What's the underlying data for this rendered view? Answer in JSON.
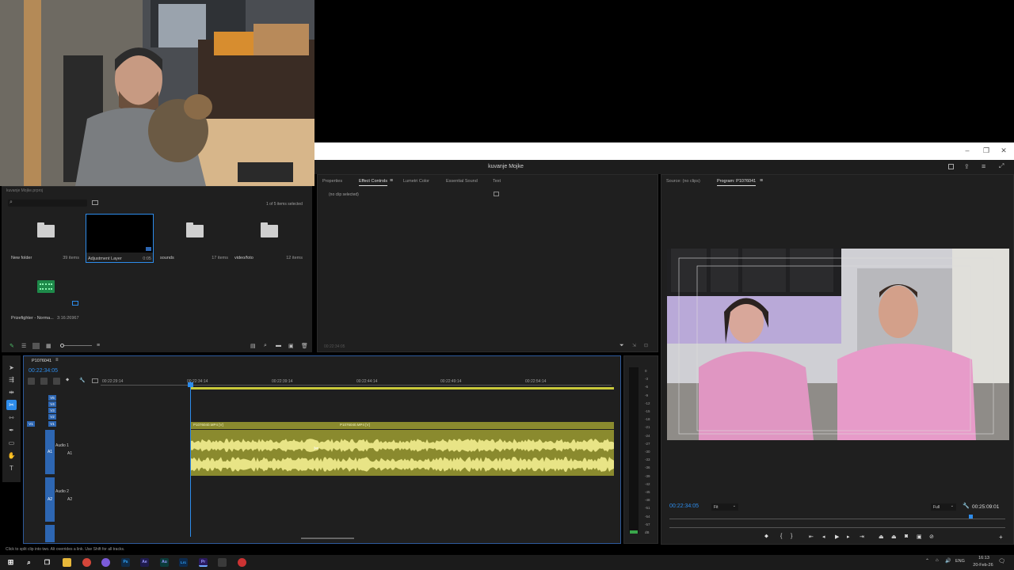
{
  "window": {
    "title": "kuvanje Mojke",
    "controls": [
      "–",
      "❐",
      "✕"
    ]
  },
  "project": {
    "path": "kuvanje Mojke.prproj",
    "items_selected": "1 of 5 items selected",
    "items": [
      {
        "name": "New folder",
        "count": "39 items",
        "kind": "folder"
      },
      {
        "name": "Adjustment Layer",
        "count": "0:05",
        "kind": "adjustment"
      },
      {
        "name": "sounds",
        "count": "17 items",
        "kind": "folder"
      },
      {
        "name": "video/foto",
        "count": "12 items",
        "kind": "folder"
      },
      {
        "name": "Prizefighter - Norma...",
        "count": "3:16:26967",
        "kind": "audio"
      }
    ]
  },
  "effects_panel": {
    "tabs": [
      "Properties",
      "Effect Controls",
      "Lumetri Color",
      "Essential Sound",
      "Text"
    ],
    "active_tab": "Effect Controls",
    "empty_message": "(no clip selected)",
    "timecode": "00:22:34:05"
  },
  "program_panel": {
    "tabs": [
      "Source: (no clips)",
      "Program: P1076041"
    ],
    "timecode": "00:22:34:05",
    "fit": "Fit",
    "resolution": "Full",
    "duration": "00:25:09:01"
  },
  "timeline": {
    "sequence": "P1076041",
    "timecode": "00:22:34:05",
    "ruler": [
      "00:22:29:14",
      "00:22:34:14",
      "00:22:39:14",
      "00:22:44:14",
      "00:22:49:14",
      "00:22:54:14"
    ],
    "video_tracks": [
      "V5",
      "V4",
      "V3",
      "V2",
      "V1"
    ],
    "audio_tracks": [
      {
        "id": "A1",
        "name": "Audio 1"
      },
      {
        "id": "A2",
        "name": "Audio 2"
      }
    ],
    "clips": [
      "P1076040.MP4 [V]",
      "P1076040.MP4 [V]"
    ]
  },
  "meter": {
    "scale": [
      "0",
      "-3",
      "-6",
      "-9",
      "-12",
      "-15",
      "-18",
      "-21",
      "-24",
      "-27",
      "-30",
      "-33",
      "-36",
      "-39",
      "-42",
      "-45",
      "-48",
      "-51",
      "-54",
      "-57",
      "dB"
    ]
  },
  "status_bar": "Click to split clip into two. Alt overrides a link. Use Shift for all tracks.",
  "taskbar": {
    "apps": [
      "Ps",
      "Ae",
      "Au",
      "Lrc",
      "Pr"
    ],
    "lang": "ENG",
    "time": "16:13",
    "date": "20-Feb-26"
  },
  "colors": {
    "accent": "#2d8ceb",
    "clip_video": "#8a8a2e",
    "clip_audio": "#e8e486",
    "panel": "#1f1f1f",
    "playhead": "#2d8ceb"
  }
}
